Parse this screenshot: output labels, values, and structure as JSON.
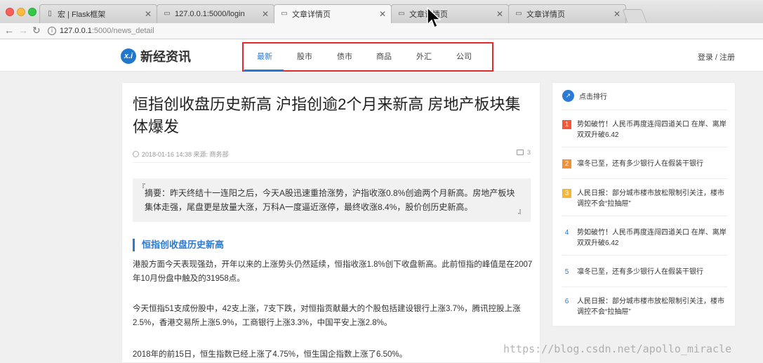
{
  "browser": {
    "tabs": [
      {
        "title": "宏 | Flask框架",
        "favicon": "book-icon"
      },
      {
        "title": "127.0.0.1:5000/login",
        "favicon": "page-icon"
      },
      {
        "title": "文章详情页",
        "favicon": "page-icon",
        "active": true
      },
      {
        "title": "文章详情页",
        "favicon": "page-icon"
      },
      {
        "title": "文章详情页",
        "favicon": "page-icon"
      }
    ],
    "url_host": "127.0.0.1",
    "url_path": ":5000/news_detail"
  },
  "header": {
    "logo_mark": "x.i",
    "logo_text": "新经资讯",
    "menu": [
      "最新",
      "股市",
      "债市",
      "商品",
      "外汇",
      "公司"
    ],
    "active_menu": "最新",
    "login": "登录 / 注册"
  },
  "article": {
    "title": "恒指创收盘历史新高 沪指创逾2个月来新高 房地产板块集体爆发",
    "meta": "2018-01-16 14:38 来源: 商务部",
    "comments": "3",
    "summary": "摘要：昨天终结十一连阳之后，今天A股迅速重拾涨势，沪指收涨0.8%创逾两个月新高。房地产板块集体走强，尾盘更是放量大涨，万科A一度逼近涨停，最终收涨8.4%，股价创历史新高。",
    "section_heading": "恒指创收盘历史新高",
    "paragraphs": [
      "港股方面今天表现强劲，开年以来的上涨势头仍然延续，恒指收涨1.8%创下收盘新高。此前恒指的峰值是在2007年10月份盘中触及的31958点。",
      "今天恒指51支成份股中，42支上涨，7支下跌，对恒指贡献最大的个股包括建设银行上涨3.7%，腾讯控股上涨2.5%，香港交易所上涨5.9%，工商银行上涨3.3%，中国平安上涨2.8%。",
      "2018年的前15日，恒生指数已经上涨了4.75%，恒生国企指数上涨了6.50%。"
    ]
  },
  "rank": {
    "title": "点击排行",
    "items": [
      {
        "num": "1",
        "text": "势如破竹！人民币再度连闯四道关口 在岸、离岸双双升破6.42"
      },
      {
        "num": "2",
        "text": "凛冬已至，还有多少银行人在假装干银行"
      },
      {
        "num": "3",
        "text": "人民日报：部分城市楼市放松限制引关注，楼市调控不会“拉抽屉”"
      },
      {
        "num": "4",
        "text": "势如破竹！人民币再度连闯四道关口 在岸、离岸双双升破6.42"
      },
      {
        "num": "5",
        "text": "凛冬已至，还有多少银行人在假装干银行"
      },
      {
        "num": "6",
        "text": "人民日报：部分城市楼市放松限制引关注，楼市调控不会“拉抽屉”"
      }
    ]
  },
  "watermark": "https://blog.csdn.net/apollo_miracle",
  "colors": {
    "accent": "#2b7ad5",
    "highlight_box": "#e32b2b",
    "rank1": "#f2573a",
    "rank2": "#f38d36",
    "rank3": "#f5b53a"
  }
}
